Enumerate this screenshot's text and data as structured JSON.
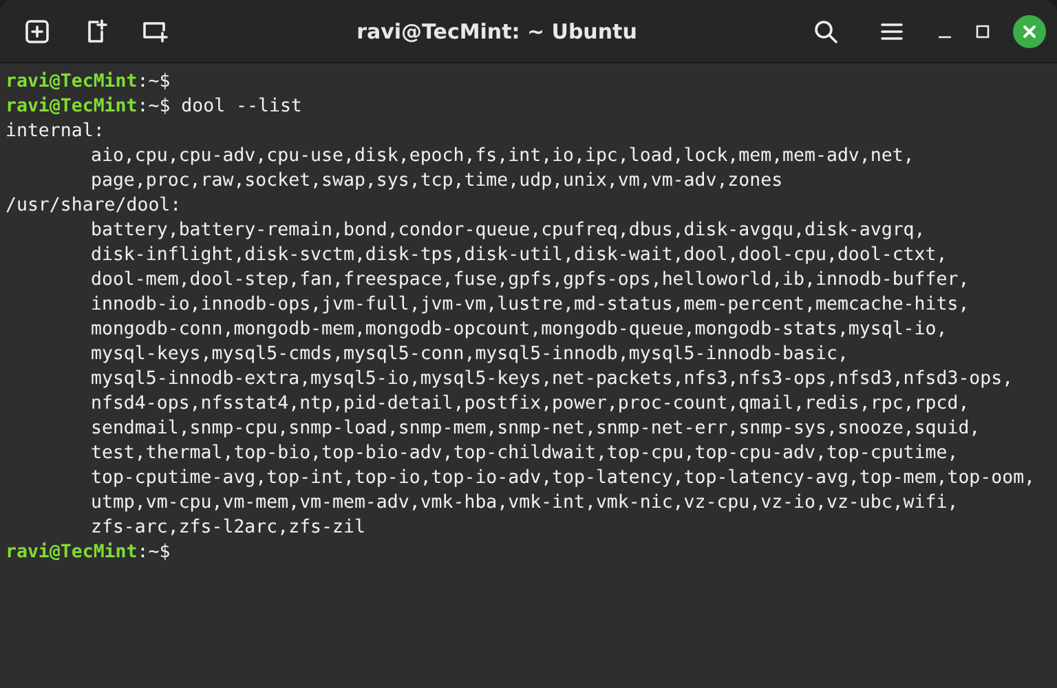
{
  "window": {
    "title": "ravi@TecMint: ~ Ubuntu"
  },
  "terminal": {
    "lines": [
      {
        "kind": "prompt",
        "user": "ravi@TecMint",
        "path": ":~$"
      },
      {
        "kind": "prompt",
        "user": "ravi@TecMint",
        "path": ":~$",
        "command": "dool --list"
      },
      {
        "kind": "output",
        "text": "internal:",
        "indented": false
      },
      {
        "kind": "output",
        "text": "aio,cpu,cpu-adv,cpu-use,disk,epoch,fs,int,io,ipc,load,lock,mem,mem-adv,net,",
        "indented": true
      },
      {
        "kind": "output",
        "text": "page,proc,raw,socket,swap,sys,tcp,time,udp,unix,vm,vm-adv,zones",
        "indented": true
      },
      {
        "kind": "output",
        "text": "/usr/share/dool:",
        "indented": false
      },
      {
        "kind": "output",
        "text": "battery,battery-remain,bond,condor-queue,cpufreq,dbus,disk-avgqu,disk-avgrq,",
        "indented": true
      },
      {
        "kind": "output",
        "text": "disk-inflight,disk-svctm,disk-tps,disk-util,disk-wait,dool,dool-cpu,dool-ctxt,",
        "indented": true
      },
      {
        "kind": "output",
        "text": "dool-mem,dool-step,fan,freespace,fuse,gpfs,gpfs-ops,helloworld,ib,innodb-buffer,",
        "indented": true
      },
      {
        "kind": "output",
        "text": "innodb-io,innodb-ops,jvm-full,jvm-vm,lustre,md-status,mem-percent,memcache-hits,",
        "indented": true
      },
      {
        "kind": "output",
        "text": "mongodb-conn,mongodb-mem,mongodb-opcount,mongodb-queue,mongodb-stats,mysql-io,",
        "indented": true
      },
      {
        "kind": "output",
        "text": "mysql-keys,mysql5-cmds,mysql5-conn,mysql5-innodb,mysql5-innodb-basic,",
        "indented": true
      },
      {
        "kind": "output",
        "text": "mysql5-innodb-extra,mysql5-io,mysql5-keys,net-packets,nfs3,nfs3-ops,nfsd3,nfsd3-ops,",
        "indented": true
      },
      {
        "kind": "output",
        "text": "nfsd4-ops,nfsstat4,ntp,pid-detail,postfix,power,proc-count,qmail,redis,rpc,rpcd,",
        "indented": true
      },
      {
        "kind": "output",
        "text": "sendmail,snmp-cpu,snmp-load,snmp-mem,snmp-net,snmp-net-err,snmp-sys,snooze,squid,",
        "indented": true
      },
      {
        "kind": "output",
        "text": "test,thermal,top-bio,top-bio-adv,top-childwait,top-cpu,top-cpu-adv,top-cputime,",
        "indented": true
      },
      {
        "kind": "output",
        "text": "top-cputime-avg,top-int,top-io,top-io-adv,top-latency,top-latency-avg,top-mem,top-oom,",
        "indented": true
      },
      {
        "kind": "output",
        "text": "utmp,vm-cpu,vm-mem,vm-mem-adv,vmk-hba,vmk-int,vmk-nic,vz-cpu,vz-io,vz-ubc,wifi,",
        "indented": true
      },
      {
        "kind": "output",
        "text": "zfs-arc,zfs-l2arc,zfs-zil",
        "indented": true
      },
      {
        "kind": "prompt",
        "user": "ravi@TecMint",
        "path": ":~$"
      }
    ]
  }
}
